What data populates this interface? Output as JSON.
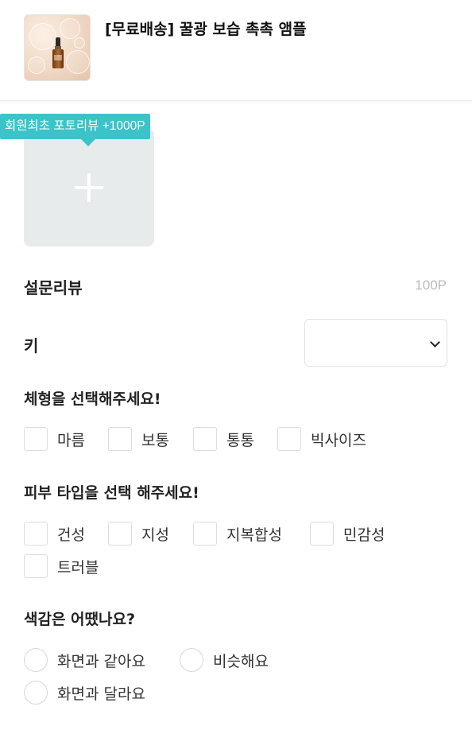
{
  "product": {
    "title": "[무료배송] 꿀광 보습 촉촉 앰플"
  },
  "photo_review": {
    "badge": "회원최초 포토리뷰 +1000P"
  },
  "survey": {
    "title": "설문리뷰",
    "points": "100P"
  },
  "height": {
    "label": "키",
    "selected": ""
  },
  "body_type": {
    "question": "체형을 선택해주세요!",
    "options": [
      "마름",
      "보통",
      "통통",
      "빅사이즈"
    ]
  },
  "skin_type": {
    "question": "피부 타입을 선택 해주세요!",
    "options": [
      "건성",
      "지성",
      "지복합성",
      "민감성",
      "트러블"
    ]
  },
  "color": {
    "question": "색감은 어땠나요?",
    "options": [
      "화면과 같아요",
      "비슷해요",
      "화면과 달라요"
    ]
  },
  "colors": {
    "accent": "#3cc3c9",
    "placeholder_bg": "#e8ebec",
    "muted_text": "#bbbbbb"
  }
}
